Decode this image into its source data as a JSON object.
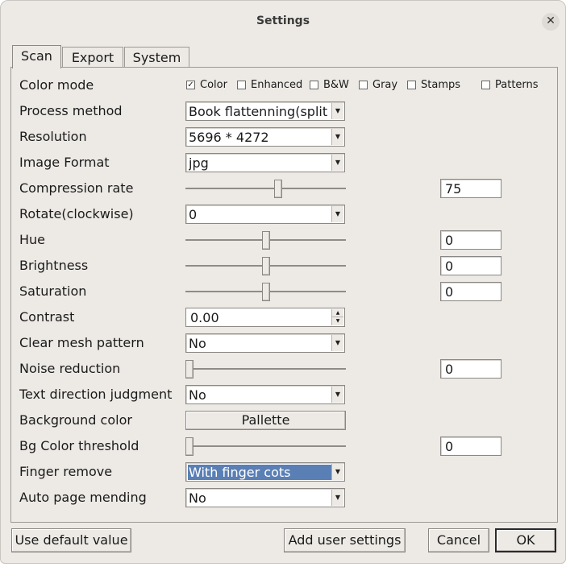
{
  "window": {
    "title": "Settings"
  },
  "tabs": [
    {
      "label": "Scan",
      "active": true
    },
    {
      "label": "Export",
      "active": false
    },
    {
      "label": "System",
      "active": false
    }
  ],
  "color_mode": {
    "label": "Color mode",
    "options": [
      {
        "label": "Color",
        "checked": true
      },
      {
        "label": "Enhanced",
        "checked": false
      },
      {
        "label": "B&W",
        "checked": false
      },
      {
        "label": "Gray",
        "checked": false
      },
      {
        "label": "Stamps",
        "checked": false
      },
      {
        "label": "Patterns",
        "checked": false
      }
    ]
  },
  "rows": {
    "process_method": {
      "label": "Process method",
      "value": "Book flattenning(split"
    },
    "resolution": {
      "label": "Resolution",
      "value": "5696 * 4272"
    },
    "image_format": {
      "label": "Image Format",
      "value": "jpg"
    },
    "compression_rate": {
      "label": "Compression rate",
      "value": "75",
      "level_percent": 58
    },
    "rotate": {
      "label": "Rotate(clockwise)",
      "value": "0"
    },
    "hue": {
      "label": "Hue",
      "value": "0",
      "level_percent": 50
    },
    "brightness": {
      "label": "Brightness",
      "value": "0",
      "level_percent": 50
    },
    "saturation": {
      "label": "Saturation",
      "value": "0",
      "level_percent": 50
    },
    "contrast": {
      "label": "Contrast",
      "value": "0.00"
    },
    "clear_mesh": {
      "label": "Clear mesh pattern",
      "value": "No"
    },
    "noise_reduction": {
      "label": "Noise reduction",
      "value": "0",
      "level_percent": 0
    },
    "text_direction": {
      "label": "Text direction judgment",
      "value": "No"
    },
    "background_color": {
      "label": "Background color",
      "button": "Pallette"
    },
    "bg_threshold": {
      "label": "Bg Color threshold",
      "value": "0",
      "level_percent": 0
    },
    "finger_remove": {
      "label": "Finger remove",
      "value": "With finger cots"
    },
    "auto_page_mending": {
      "label": "Auto page mending",
      "value": "No"
    }
  },
  "footer": {
    "default_button": "Use default value",
    "add_user_button": "Add user settings",
    "cancel_button": "Cancel",
    "ok_button": "OK"
  },
  "colors": {
    "selection": "#5a7fb5",
    "window_bg": "#edeae6"
  }
}
